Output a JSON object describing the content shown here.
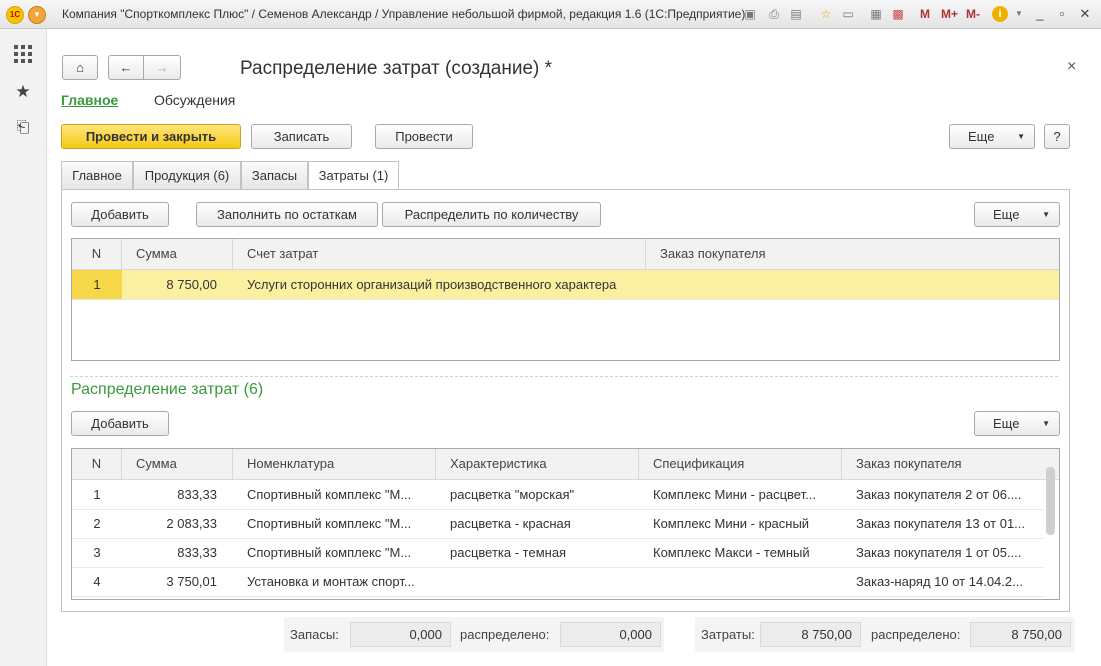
{
  "window": {
    "title": "Компания \"Спорткомплекс Плюс\" / Семенов Александр / Управление небольшой фирмой, редакция 1.6  (1С:Предприятие)",
    "tools": [
      "M",
      "M+",
      "M-"
    ]
  },
  "document": {
    "title": "Распределение затрат (создание) *"
  },
  "nav_tabs": [
    {
      "label": "Главное"
    },
    {
      "label": "Обсуждения"
    }
  ],
  "toolbar": {
    "post_close": "Провести и закрыть",
    "save": "Записать",
    "post": "Провести",
    "more": "Еще",
    "help": "?"
  },
  "tabs": [
    {
      "label": "Главное"
    },
    {
      "label": "Продукция (6)"
    },
    {
      "label": "Запасы"
    },
    {
      "label": "Затраты (1)"
    }
  ],
  "costs_toolbar": {
    "add": "Добавить",
    "fill": "Заполнить по остаткам",
    "distribute": "Распределить по количеству",
    "more": "Еще"
  },
  "costs_table": {
    "columns": [
      "N",
      "Сумма",
      "Счет затрат",
      "Заказ покупателя"
    ],
    "rows": [
      {
        "n": "1",
        "sum": "8 750,00",
        "account": "Услуги сторонних организаций производственного характера",
        "order": ""
      }
    ]
  },
  "distribution": {
    "title": "Распределение затрат (6)",
    "add": "Добавить",
    "more": "Еще",
    "columns": [
      "N",
      "Сумма",
      "Номенклатура",
      "Характеристика",
      "Спецификация",
      "Заказ покупателя"
    ],
    "rows": [
      {
        "n": "1",
        "sum": "833,33",
        "item": "Спортивный комплекс \"М...",
        "char": "расцветка \"морская\"",
        "spec": "Комплекс Мини - расцвет...",
        "order": "Заказ покупателя 2 от 06...."
      },
      {
        "n": "2",
        "sum": "2 083,33",
        "item": "Спортивный комплекс \"М...",
        "char": "расцветка - красная",
        "spec": "Комплекс Мини - красный",
        "order": "Заказ покупателя 13 от 01..."
      },
      {
        "n": "3",
        "sum": "833,33",
        "item": "Спортивный комплекс \"М...",
        "char": "расцветка - темная",
        "spec": "Комплекс Макси - темный",
        "order": "Заказ покупателя 1 от 05...."
      },
      {
        "n": "4",
        "sum": "3 750,01",
        "item": "Установка и монтаж спорт...",
        "char": "",
        "spec": "",
        "order": "Заказ-наряд 10 от 14.04.2..."
      }
    ]
  },
  "footer": {
    "stocks_label": "Запасы:",
    "stocks_value": "0,000",
    "stocks_dist_label": "распределено:",
    "stocks_dist_value": "0,000",
    "costs_label": "Затраты:",
    "costs_value": "8 750,00",
    "costs_dist_label": "распределено:",
    "costs_dist_value": "8 750,00"
  },
  "colors": {
    "accent_green": "#3a9a3a",
    "primary_button": "#f5c816",
    "selected_row": "#fbf0a0"
  }
}
